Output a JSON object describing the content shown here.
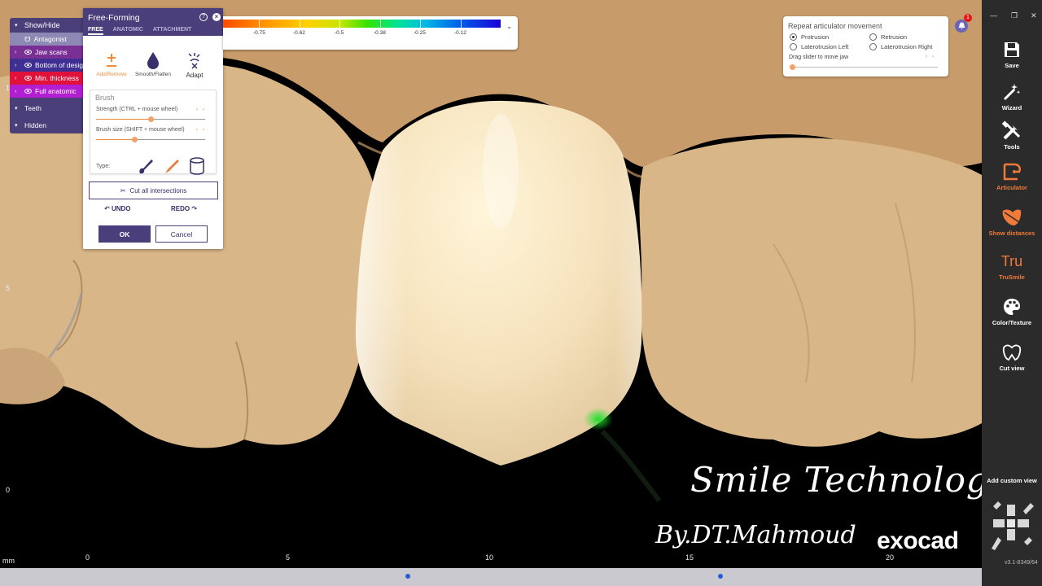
{
  "colors": {
    "accent": "#4b3f7b",
    "orange": "#f08a3c",
    "tooth_beige": "#d6b084",
    "sidebar_bg": "#2b2b2b"
  },
  "showhide": {
    "title": "Show/Hide",
    "items": [
      {
        "label": "Antagonist",
        "icon": "tooth-icon"
      },
      {
        "label": "Jaw scans",
        "icon": "eye-icon"
      },
      {
        "label": "Bottom of design",
        "icon": "eye-icon"
      },
      {
        "label": "Min. thickness",
        "icon": "eye-icon"
      },
      {
        "label": "Full anatomic",
        "icon": "eye-icon"
      }
    ],
    "teeth": "Teeth",
    "hidden": "Hidden"
  },
  "freeform": {
    "title": "Free-Forming",
    "tabs": [
      "FREE",
      "ANATOMIC",
      "ATTACHMENT"
    ],
    "active_tab": "FREE",
    "tools": {
      "add": "Add/Remove",
      "smooth": "Smooth/Flatten",
      "adapt": "Adapt"
    },
    "brush_title": "Brush",
    "strength_label": "Strength (CTRL + mouse wheel)",
    "strength_value": 0.5,
    "size_label": "Brush size (SHIFT + mouse wheel)",
    "size_value": 0.35,
    "type_label": "Type:",
    "cut_label": "Cut all intersections",
    "undo": "UNDO",
    "redo": "REDO",
    "ok": "OK",
    "cancel": "Cancel"
  },
  "colorscale": {
    "values": [
      "-0.75",
      "-0.62",
      "-0.5",
      "-0.38",
      "-0.25",
      "-0.12"
    ]
  },
  "articulator": {
    "title": "Repeat articulator movement",
    "options": [
      "Protrusion",
      "Retrusion",
      "Laterotrusion Left",
      "Laterotrusion Right"
    ],
    "selected": "Protrusion",
    "drag_label": "Drag slider to move jaw"
  },
  "notifications": {
    "count": "1"
  },
  "ruler": {
    "unit": "mm",
    "x_ticks": [
      "0",
      "5",
      "10",
      "15",
      "20"
    ],
    "y_ticks": [
      "1",
      "5",
      "0"
    ]
  },
  "sidebar": {
    "items": [
      {
        "label": "Save",
        "icon": "save-icon"
      },
      {
        "label": "Wizard",
        "icon": "wizard-icon"
      },
      {
        "label": "Tools",
        "icon": "tools-icon"
      },
      {
        "label": "Articulator",
        "icon": "articulator-icon"
      },
      {
        "label": "Show distances",
        "icon": "distances-icon"
      },
      {
        "label": "TruSmile",
        "icon": "trusmile-icon",
        "icon_text": "Tru"
      },
      {
        "label": "Color/Texture",
        "icon": "palette-icon"
      },
      {
        "label": "Cut view",
        "icon": "cutview-icon"
      }
    ],
    "custom_view": "Add custom view",
    "version": "v3.1-8349/64"
  },
  "watermark": {
    "line1": "Smile Technology",
    "line2": "By.DT.Mahmoud",
    "brand": "exocad"
  }
}
